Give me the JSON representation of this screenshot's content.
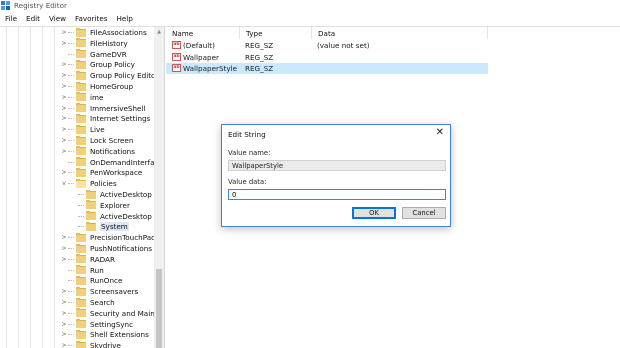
{
  "window": {
    "title": "Registry Editor",
    "icon": "regedit-icon"
  },
  "menu": [
    "File",
    "Edit",
    "View",
    "Favorites",
    "Help"
  ],
  "tree": {
    "items": [
      {
        "label": "FileAssociations",
        "expander": ">",
        "open": false
      },
      {
        "label": "FileHistory",
        "expander": ">",
        "open": false
      },
      {
        "label": "GameDVR",
        "expander": "",
        "open": false
      },
      {
        "label": "Group Policy",
        "expander": ">",
        "open": false
      },
      {
        "label": "Group Policy Editor",
        "expander": ">",
        "open": false
      },
      {
        "label": "HomeGroup",
        "expander": ">",
        "open": false
      },
      {
        "label": "ime",
        "expander": ">",
        "open": false
      },
      {
        "label": "ImmersiveShell",
        "expander": ">",
        "open": false
      },
      {
        "label": "Internet Settings",
        "expander": ">",
        "open": false
      },
      {
        "label": "Live",
        "expander": ">",
        "open": false
      },
      {
        "label": "Lock Screen",
        "expander": ">",
        "open": false
      },
      {
        "label": "Notifications",
        "expander": ">",
        "open": false
      },
      {
        "label": "OnDemandInterfaceCa",
        "expander": "",
        "open": false
      },
      {
        "label": "PenWorkspace",
        "expander": ">",
        "open": false
      },
      {
        "label": "Policies",
        "expander": "v",
        "open": true
      },
      {
        "label": "ActiveDesktop",
        "expander": "",
        "open": false,
        "child": true
      },
      {
        "label": "Explorer",
        "expander": "",
        "open": false,
        "child": true
      },
      {
        "label": "ActiveDesktop",
        "expander": "",
        "open": false,
        "child": true
      },
      {
        "label": "System",
        "expander": "",
        "open": false,
        "child": true,
        "selected": true
      },
      {
        "label": "PrecisionTouchPad",
        "expander": ">",
        "open": false
      },
      {
        "label": "PushNotifications",
        "expander": ">",
        "open": false
      },
      {
        "label": "RADAR",
        "expander": ">",
        "open": false
      },
      {
        "label": "Run",
        "expander": "",
        "open": false
      },
      {
        "label": "RunOnce",
        "expander": "",
        "open": false
      },
      {
        "label": "Screensavers",
        "expander": ">",
        "open": false
      },
      {
        "label": "Search",
        "expander": ">",
        "open": false
      },
      {
        "label": "Security and Maintena",
        "expander": ">",
        "open": false
      },
      {
        "label": "SettingSync",
        "expander": ">",
        "open": false
      },
      {
        "label": "Shell Extensions",
        "expander": ">",
        "open": false
      },
      {
        "label": "Skydrive",
        "expander": ">",
        "open": false
      }
    ]
  },
  "list": {
    "columns": [
      "Name",
      "Type",
      "Data"
    ],
    "rows": [
      {
        "name": "(Default)",
        "type": "REG_SZ",
        "data": "(value not set)",
        "selected": false
      },
      {
        "name": "Wallpaper",
        "type": "REG_SZ",
        "data": "",
        "selected": false
      },
      {
        "name": "WallpaperStyle",
        "type": "REG_SZ",
        "data": "",
        "selected": true
      }
    ]
  },
  "dialog": {
    "title": "Edit String",
    "close_glyph": "✕",
    "value_name_label": "Value name:",
    "value_name": "WallpaperStyle",
    "value_data_label": "Value data:",
    "value_data": "0",
    "ok_label": "OK",
    "cancel_label": "Cancel"
  }
}
